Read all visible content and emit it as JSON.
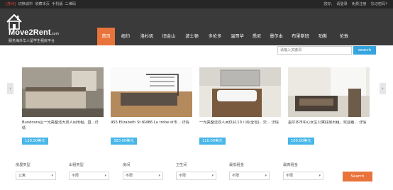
{
  "topbar": {
    "left": [
      {
        "text": "[苏州]",
        "red": true
      },
      {
        "text": "切换城市",
        "red": false
      },
      {
        "text": "收藏本页",
        "red": false
      },
      {
        "text": "手机版",
        "red": false
      },
      {
        "text": "二维码",
        "red": false
      }
    ],
    "right": [
      "您好,",
      "请登录",
      "免费注册",
      "忘记密码?"
    ]
  },
  "logo": {
    "brand": "Move2Rent",
    "domain": ".com",
    "tagline": "服务海外华人留学生租房平台"
  },
  "nav": [
    {
      "label": "首页",
      "active": true
    },
    {
      "label": "纽约",
      "active": false
    },
    {
      "label": "洛杉矶",
      "active": false
    },
    {
      "label": "旧金山",
      "active": false
    },
    {
      "label": "波士顿",
      "active": false
    },
    {
      "label": "多伦多",
      "active": false
    },
    {
      "label": "温哥华",
      "active": false
    },
    {
      "label": "悉尼",
      "active": false
    },
    {
      "label": "墨尔本",
      "active": false
    },
    {
      "label": "布里斯班",
      "active": false
    },
    {
      "label": "珀斯",
      "active": false
    },
    {
      "label": "伦敦",
      "active": false
    }
  ],
  "search": {
    "placeholder": "请输入关键词",
    "button": "search"
  },
  "carousel": {
    "prev": "‹",
    "next": "›"
  },
  "listings": [
    {
      "title": "Bundoora区一光亮整洁大双人间出租，直...详情",
      "price": "130.00美元"
    },
    {
      "title": "455 Elizabeth St 和486 La trobe st市... 详情",
      "price": "320.00美元"
    },
    {
      "title": "一光亮整洁双人间仅$110 / 周(全包)，交... 详情",
      "price": "110.00美元"
    },
    {
      "title": "墨尔本市中心女生公寓好房出租，欢迎看... 详情",
      "price": "100.00美元"
    }
  ],
  "filters": [
    {
      "label": "房屋类型",
      "value": "公寓"
    },
    {
      "label": "出租类型",
      "value": "不限"
    },
    {
      "label": "房间",
      "value": "不限"
    },
    {
      "label": "卫生间",
      "value": "不限"
    },
    {
      "label": "最低租金",
      "value": "不限"
    },
    {
      "label": "最高租金",
      "value": "不限"
    }
  ],
  "filter_button": "Search"
}
